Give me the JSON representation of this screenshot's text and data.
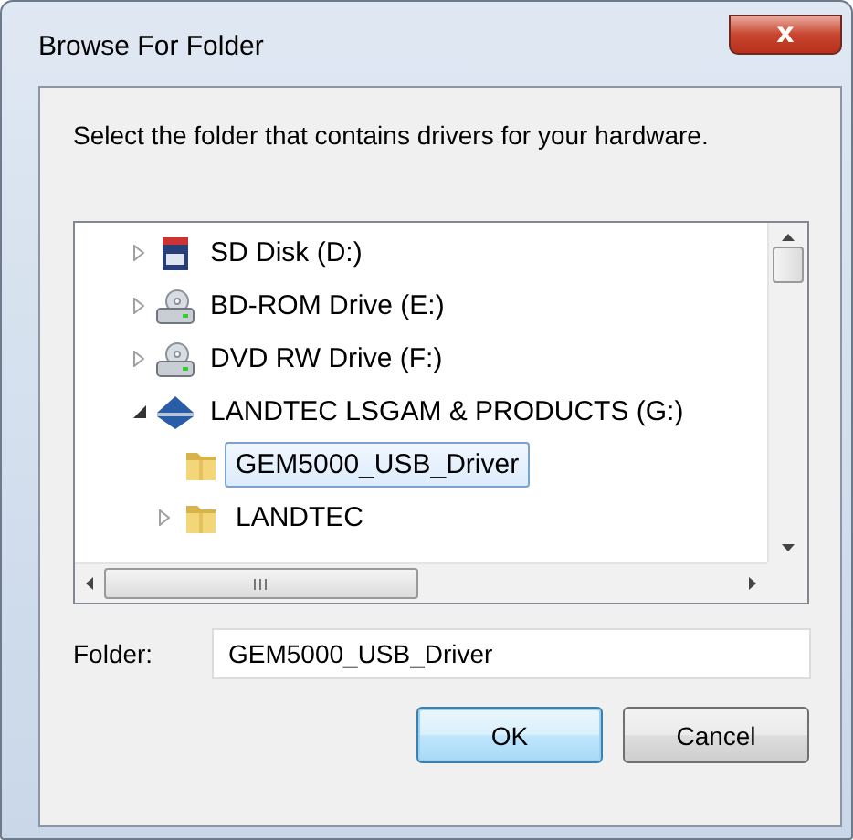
{
  "window": {
    "title": "Browse For Folder",
    "close_label": "x"
  },
  "instruction": "Select the folder that contains drivers for your hardware.",
  "tree": {
    "items": [
      {
        "label": "SD Disk (D:)",
        "kind": "sd",
        "expanded": false,
        "selected": false
      },
      {
        "label": "BD-ROM Drive (E:)",
        "kind": "optical",
        "expanded": false,
        "selected": false
      },
      {
        "label": "DVD RW Drive (F:)",
        "kind": "optical",
        "expanded": false,
        "selected": false
      },
      {
        "label": "LANDTEC LSGAM & PRODUCTS (G:)",
        "kind": "network",
        "expanded": true,
        "selected": false,
        "children": [
          {
            "label": "GEM5000_USB_Driver",
            "kind": "folder",
            "selected": true
          },
          {
            "label": "LANDTEC",
            "kind": "folder",
            "expanded": false,
            "selected": false
          }
        ]
      }
    ]
  },
  "folder_field": {
    "label": "Folder:",
    "value": "GEM5000_USB_Driver"
  },
  "buttons": [
    {
      "label": "OK",
      "default": true
    },
    {
      "label": "Cancel",
      "default": false
    }
  ]
}
